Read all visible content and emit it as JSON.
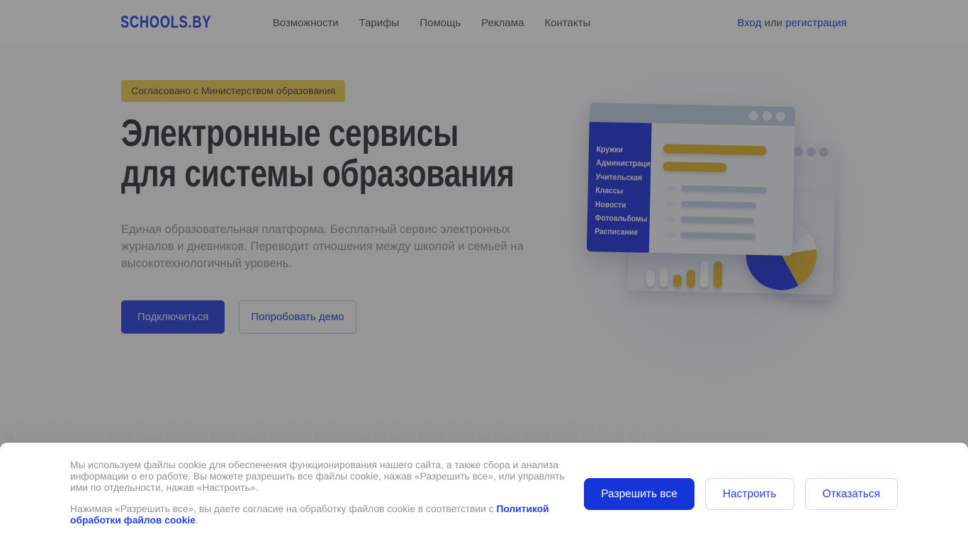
{
  "brand": {
    "logo": "SCHOOLS.BY"
  },
  "nav": {
    "items": [
      "Возможности",
      "Тарифы",
      "Помощь",
      "Реклама",
      "Контакты"
    ]
  },
  "auth": {
    "login": "Вход",
    "separator": " или ",
    "register": "регистрация"
  },
  "hero": {
    "badge": "Согласовано с Министерством образования",
    "title_line1": "Электронные сервисы",
    "title_line2": "для системы образования",
    "description": "Единая образовательная платформа. Бесплатный сервис электронных журналов и дневников. Переводит отношения между школой и семьей на высокотехнологичный уровень.",
    "cta_primary": "Подключиться",
    "cta_secondary": "Попробовать демо"
  },
  "illustration": {
    "menu": [
      "Кружки",
      "Администрация",
      "Учительская",
      "Классы",
      "Новости",
      "Фотоальбомы",
      "Расписание"
    ]
  },
  "cookie": {
    "p1": "Мы используем файлы cookie для обеспечения функционирования нашего сайта, а также сбора и анализа информации о его работе. Вы можете разрешить все файлы cookie, нажав «Разрешить все», или управлять ими по отдельности, нажав «Настроить».",
    "p2_before": "Нажимая «Разрешить все», вы даете согласие на обработку файлов cookie в соответствии с ",
    "p2_link": "Политикой обработки файлов cookie",
    "p2_after": ".",
    "btn_allow": "Разрешить все",
    "btn_configure": "Настроить",
    "btn_decline": "Отказаться"
  },
  "colors": {
    "brand_blue": "#3a50e0",
    "accent_blue": "#1535d8",
    "badge_yellow": "#f0d268",
    "illustration_blue": "#3a4ae2",
    "illustration_yellow": "#e4bc4a",
    "dim_overlay": "rgba(0,0,0,0.4)"
  }
}
